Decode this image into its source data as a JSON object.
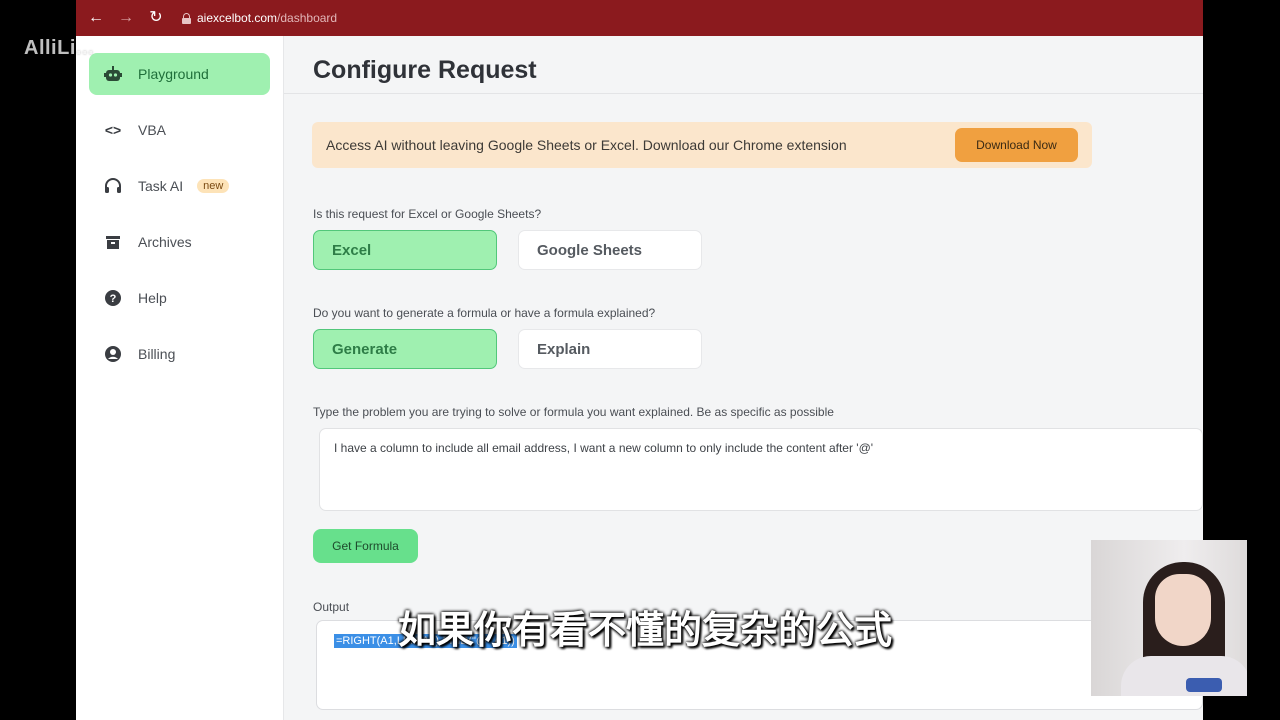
{
  "browser": {
    "url_host": "aiexcelbot.com",
    "url_path": "/dashboard",
    "back_glyph": "←",
    "forward_glyph": "→",
    "reload_glyph": "↻"
  },
  "sidebar": {
    "items": [
      {
        "label": "Playground",
        "icon": "robot-icon",
        "active": true
      },
      {
        "label": "VBA",
        "icon": "code-icon",
        "glyph": "<>"
      },
      {
        "label": "Task AI",
        "icon": "headset-icon",
        "badge": "new"
      },
      {
        "label": "Archives",
        "icon": "archive-icon"
      },
      {
        "label": "Help",
        "icon": "help-icon",
        "glyph": "?"
      },
      {
        "label": "Billing",
        "icon": "account-icon"
      }
    ]
  },
  "main": {
    "title": "Configure Request",
    "banner": {
      "text": "Access AI without leaving Google Sheets or Excel. Download our Chrome extension",
      "button": "Download Now"
    },
    "q1": {
      "label": "Is this request for Excel or Google Sheets?",
      "options": [
        "Excel",
        "Google Sheets"
      ],
      "selected": "Excel"
    },
    "q2": {
      "label": "Do you want to generate a formula or have a formula explained?",
      "options": [
        "Generate",
        "Explain"
      ],
      "selected": "Generate"
    },
    "q3": {
      "label": "Type the problem you are trying to solve or formula you want explained. Be as specific as possible",
      "value": "I have a column to include all email address, I want a new column to only include the content after '@'"
    },
    "submit": "Get Formula",
    "output": {
      "label": "Output",
      "value": "=RIGHT(A1,LEN(A1)-FIND(\"@\",A1))"
    }
  },
  "overlay": {
    "watermark": "AlliLi...",
    "subtitle": "如果你有看不懂的复杂的公式"
  },
  "colors": {
    "browser_bar": "#8b1a1e",
    "accent_green": "#9ff0b0",
    "button_green": "#67e08c",
    "banner_bg": "#fbe6cc",
    "banner_button": "#f0a040",
    "selection_blue": "#3b8fe6"
  }
}
